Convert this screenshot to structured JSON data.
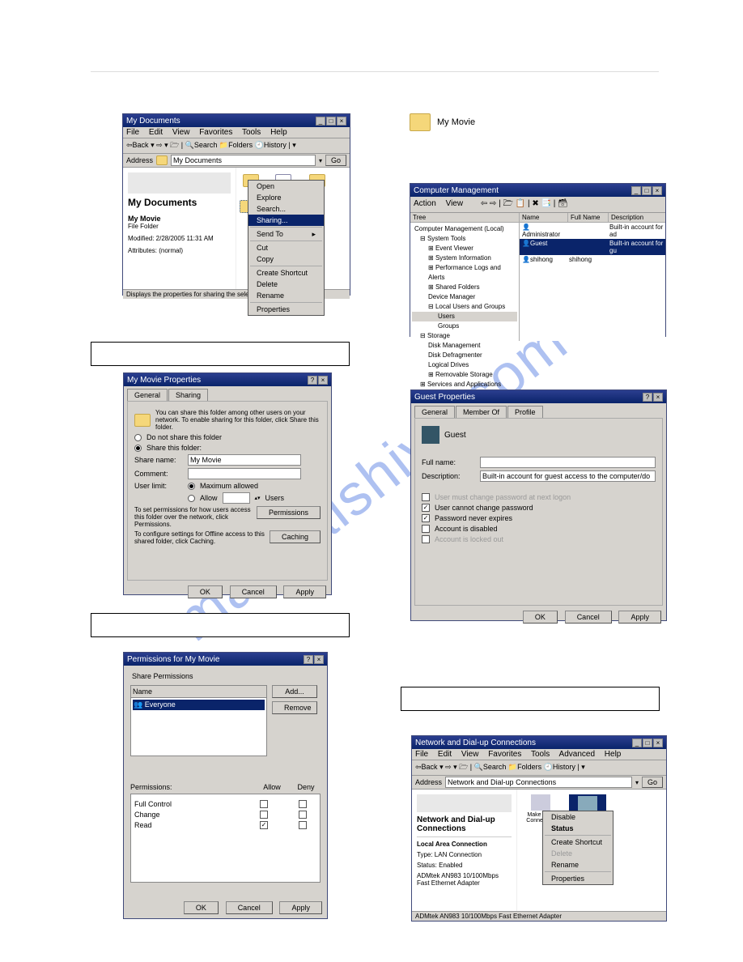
{
  "watermark": "manualshive.com",
  "explorer": {
    "title": "My Documents",
    "menu": [
      "File",
      "Edit",
      "View",
      "Favorites",
      "Tools",
      "Help"
    ],
    "toolbar": {
      "back": "Back",
      "search": "Search",
      "folders": "Folders",
      "history": "History"
    },
    "address_label": "Address",
    "address_value": "My Documents",
    "go": "Go",
    "panel_heading": "My Documents",
    "selected_name": "My Movie",
    "selected_type": "File Folder",
    "modified": "Modified: 2/28/2005 11:31 AM",
    "attributes": "Attributes: (normal)",
    "status": "Displays the properties for sharing the selected fo",
    "context": [
      "Open",
      "Explore",
      "Search..."
    ],
    "context_hl": "Sharing...",
    "context2": [
      "Send To"
    ],
    "context3": [
      "Cut",
      "Copy"
    ],
    "context4": [
      "Create Shortcut",
      "Delete",
      "Rename"
    ],
    "context5": [
      "Properties"
    ]
  },
  "mymovie": {
    "label": "My Movie"
  },
  "props": {
    "title": "My Movie Properties",
    "tabs": [
      "General",
      "Sharing"
    ],
    "blurb": "You can share this folder among other users on your network. To enable sharing for this folder, click Share this folder.",
    "opt_noshare": "Do not share this folder",
    "opt_share": "Share this folder:",
    "share_name_lbl": "Share name:",
    "share_name": "My Movie",
    "comment_lbl": "Comment:",
    "userlimit_lbl": "User limit:",
    "max": "Maximum allowed",
    "allow": "Allow",
    "users": "Users",
    "perm_blurb": "To set permissions for how users access this folder over the network, click Permissions.",
    "cache_blurb": "To configure settings for Offline access to this shared folder, click Caching.",
    "btn_perm": "Permissions",
    "btn_cache": "Caching",
    "ok": "OK",
    "cancel": "Cancel",
    "apply": "Apply"
  },
  "perms": {
    "title": "Permissions for My Movie",
    "group": "Share Permissions",
    "name_hdr": "Name",
    "everyone": "Everyone",
    "add": "Add...",
    "remove": "Remove",
    "perm_hdr": "Permissions:",
    "allow": "Allow",
    "deny": "Deny",
    "rows": [
      "Full Control",
      "Change",
      "Read"
    ],
    "ok": "OK",
    "cancel": "Cancel",
    "apply": "Apply"
  },
  "compmgmt": {
    "title": "Computer Management",
    "menu": [
      "Action",
      "View"
    ],
    "tree_label": "Tree",
    "cols": [
      "Name",
      "Full Name",
      "Description"
    ],
    "users": [
      {
        "name": "Administrator",
        "full": "",
        "desc": "Built-in account for ad"
      },
      {
        "name": "Guest",
        "full": "",
        "desc": "Built-in account for gu"
      },
      {
        "name": "shihong",
        "full": "shihong",
        "desc": ""
      }
    ],
    "tree": [
      "Computer Management (Local)",
      " System Tools",
      "  Event Viewer",
      "  System Information",
      "  Performance Logs and Alerts",
      "  Shared Folders",
      "  Device Manager",
      "  Local Users and Groups",
      "   Users",
      "   Groups",
      " Storage",
      "  Disk Management",
      "  Disk Defragmenter",
      "  Logical Drives",
      "  Removable Storage",
      " Services and Applications"
    ]
  },
  "guest": {
    "title": "Guest Properties",
    "tabs": [
      "General",
      "Member Of",
      "Profile"
    ],
    "name": "Guest",
    "full_lbl": "Full name:",
    "desc_lbl": "Description:",
    "desc_val": "Built-in account for guest access to the computer/do",
    "c1": "User must change password at next logon",
    "c2": "User cannot change password",
    "c3": "Password never expires",
    "c4": "Account is disabled",
    "c5": "Account is locked out",
    "ok": "OK",
    "cancel": "Cancel",
    "apply": "Apply"
  },
  "netconn": {
    "title": "Network and Dial-up Connections",
    "menu": [
      "File",
      "Edit",
      "View",
      "Favorites",
      "Tools",
      "Advanced",
      "Help"
    ],
    "toolbar": {
      "back": "Back",
      "search": "Search",
      "folders": "Folders",
      "history": "History"
    },
    "address_label": "Address",
    "address_value": "Network and Dial-up Connections",
    "go": "Go",
    "heading": "Network and Dial-up Connections",
    "item1": "Make New Connection",
    "item2": "Local Area Conn",
    "sel_head": "Local Area Connection",
    "type": "Type: LAN Connection",
    "status": "Status: Enabled",
    "adapter": "ADMtek AN983 10/100Mbps Fast Ethernet Adapter",
    "context": [
      "Disable",
      "Status"
    ],
    "context2": [
      "Create Shortcut",
      "Delete",
      "Rename"
    ],
    "context3": [
      "Properties"
    ],
    "statusbar": "ADMtek AN983 10/100Mbps Fast Ethernet Adapter"
  }
}
